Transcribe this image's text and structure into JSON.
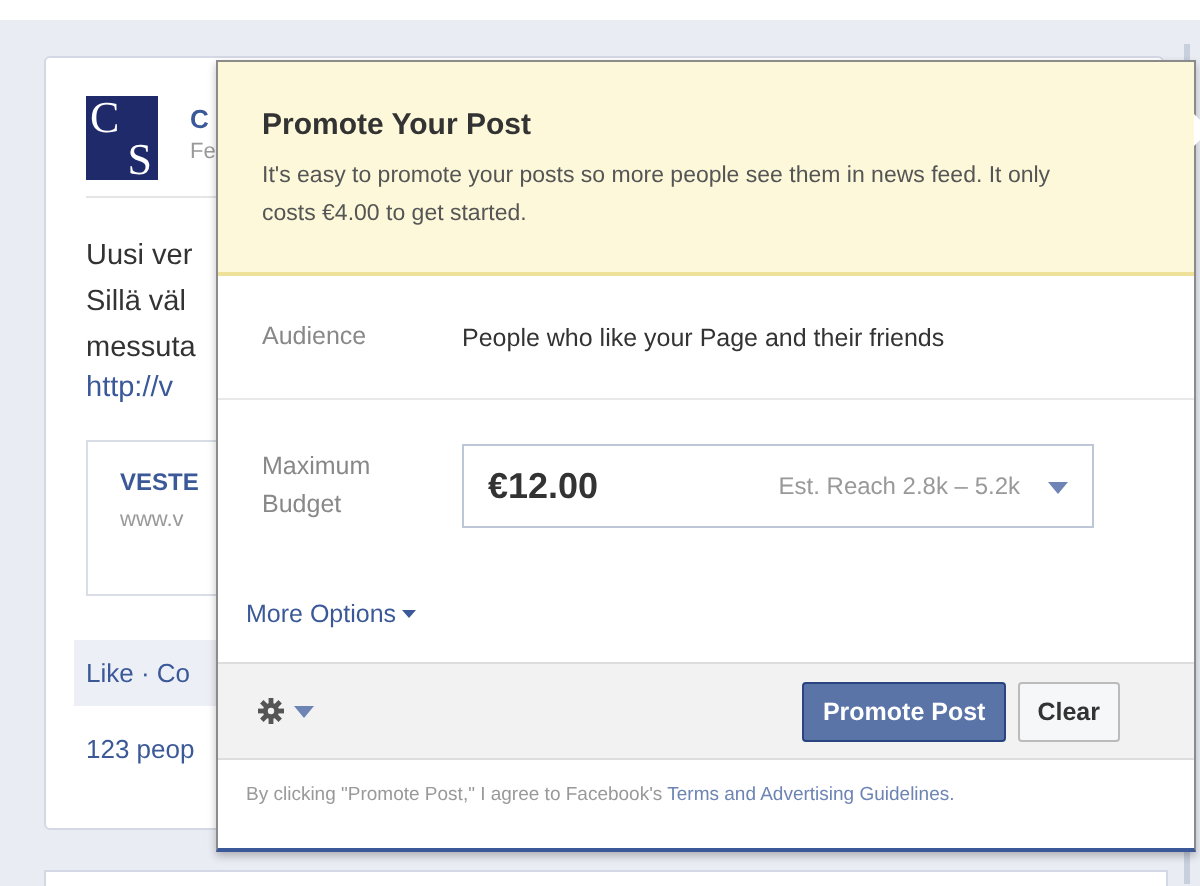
{
  "post": {
    "avatar_letters": [
      "C",
      "S"
    ],
    "author": "C",
    "date": "Fe",
    "body_lines": [
      "Uusi ver",
      "Sillä väl",
      "messuta"
    ],
    "link": "http://v",
    "preview": {
      "title": "VESTE",
      "url": "www.v"
    },
    "actions": "Like · Co",
    "likes": "123 peop"
  },
  "popup": {
    "title": "Promote Your Post",
    "description": "It's easy to promote your posts so more people see them in news feed. It only costs €4.00 to get started.",
    "audience": {
      "label": "Audience",
      "value": "People who like your Page and their friends"
    },
    "budget": {
      "label": "Maximum Budget",
      "amount": "€12.00",
      "reach": "Est. Reach 2.8k – 5.2k"
    },
    "more_options": "More Options",
    "buttons": [
      {
        "label": "Promote Post",
        "kind": "primary"
      },
      {
        "label": "Clear",
        "kind": "secondary"
      }
    ],
    "legal": {
      "text": "By clicking \"Promote Post,\" I agree to Facebook's ",
      "link": "Terms and Advertising Guidelines."
    }
  }
}
